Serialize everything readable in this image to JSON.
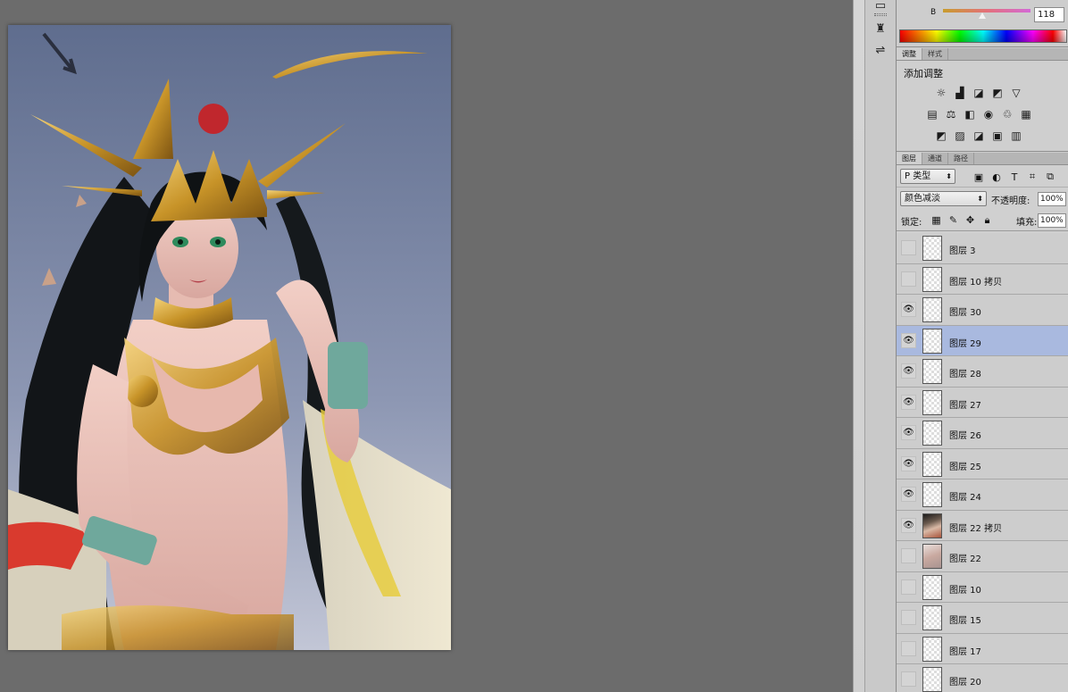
{
  "color_panel": {
    "b_label": "B",
    "b_value": "118"
  },
  "adjustments": {
    "tabs": [
      "调整",
      "样式"
    ],
    "title": "添加调整",
    "row1_icons": [
      "brightness-contrast-icon",
      "levels-icon",
      "curves-icon",
      "exposure-icon",
      "vibrance-icon"
    ],
    "row2_icons": [
      "hue-saturation-icon",
      "color-balance-icon",
      "black-white-icon",
      "photo-filter-icon",
      "channel-mixer-icon",
      "color-lookup-icon"
    ],
    "row3_icons": [
      "invert-icon",
      "posterize-icon",
      "threshold-icon",
      "selective-color-icon",
      "gradient-map-icon"
    ]
  },
  "layers_panel": {
    "tabs": [
      "图层",
      "通道",
      "路径"
    ],
    "filter_kind": "P 类型",
    "blend_mode": "颜色减淡",
    "opacity_label": "不透明度:",
    "opacity_value": "100%",
    "lock_label": "锁定:",
    "fill_label": "填充:",
    "fill_value": "100%",
    "layers": [
      {
        "name": "图层 3",
        "visible": false,
        "selected": false,
        "thumb": "empty"
      },
      {
        "name": "图层 10 拷贝",
        "visible": false,
        "selected": false,
        "thumb": "empty"
      },
      {
        "name": "图层 30",
        "visible": true,
        "selected": false,
        "thumb": "empty"
      },
      {
        "name": "图层 29",
        "visible": true,
        "selected": true,
        "thumb": "empty"
      },
      {
        "name": "图层 28",
        "visible": true,
        "selected": false,
        "thumb": "empty"
      },
      {
        "name": "图层 27",
        "visible": true,
        "selected": false,
        "thumb": "empty"
      },
      {
        "name": "图层 26",
        "visible": true,
        "selected": false,
        "thumb": "empty"
      },
      {
        "name": "图层 25",
        "visible": true,
        "selected": false,
        "thumb": "empty"
      },
      {
        "name": "图层 24",
        "visible": true,
        "selected": false,
        "thumb": "empty"
      },
      {
        "name": "图层 22 拷贝",
        "visible": true,
        "selected": false,
        "thumb": "art"
      },
      {
        "name": "图层 22",
        "visible": false,
        "selected": false,
        "thumb": "art2"
      },
      {
        "name": "图层 10",
        "visible": false,
        "selected": false,
        "thumb": "empty"
      },
      {
        "name": "图层 15",
        "visible": false,
        "selected": false,
        "thumb": "empty"
      },
      {
        "name": "图层 17",
        "visible": false,
        "selected": false,
        "thumb": "empty"
      },
      {
        "name": "图层 20",
        "visible": false,
        "selected": false,
        "thumb": "empty"
      }
    ]
  },
  "colors": {
    "selected_layer": "#a9b9df",
    "panel_bg": "#cbcbcb",
    "workspace_bg": "#6c6c6c"
  }
}
